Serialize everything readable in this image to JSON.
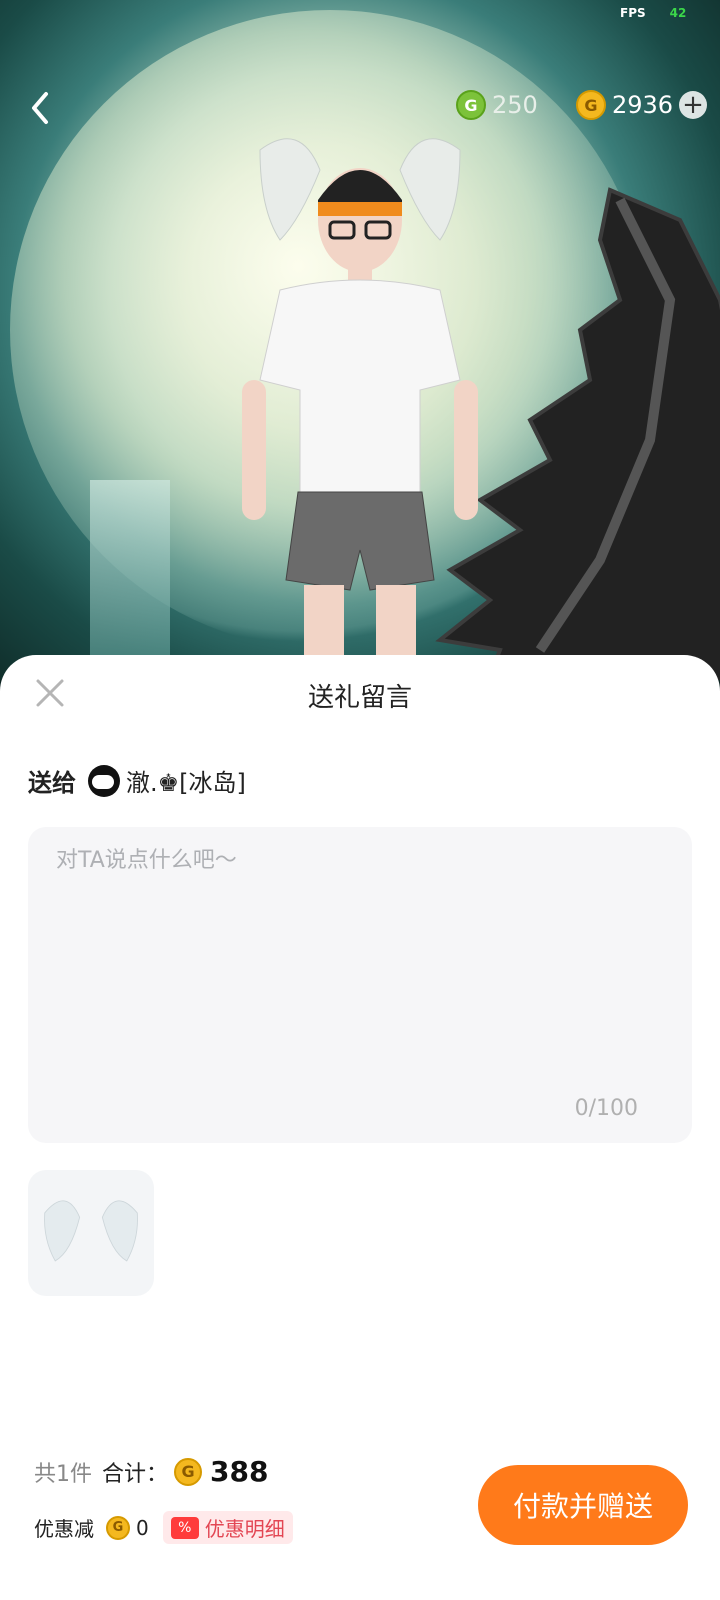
{
  "status": {
    "fps_label": "FPS",
    "fps_value": "42"
  },
  "wallet": {
    "green_coin": {
      "value": "250",
      "icon": "green-g-coin-icon"
    },
    "gold_coin": {
      "value": "2936",
      "icon": "gold-g-coin-icon"
    },
    "add_icon": "plus-circle-icon"
  },
  "sheet": {
    "title": "送礼留言",
    "recipient_label": "送给",
    "recipient_name": "澈.♚[冰岛]",
    "message_placeholder": "对TA说点什么吧〜",
    "char_counter": "0/100"
  },
  "summary": {
    "count_text": "共1件",
    "total_label": "合计：",
    "total_amount": "388",
    "discount_label": "优惠减",
    "discount_value": "0",
    "discount_detail_label": "优惠明细",
    "pay_button_label": "付款并赠送"
  },
  "colors": {
    "accent": "#ff7a1a",
    "coin_gold": "#f4b81f",
    "coin_green": "#7cc23a",
    "discount_red": "#e34653"
  }
}
